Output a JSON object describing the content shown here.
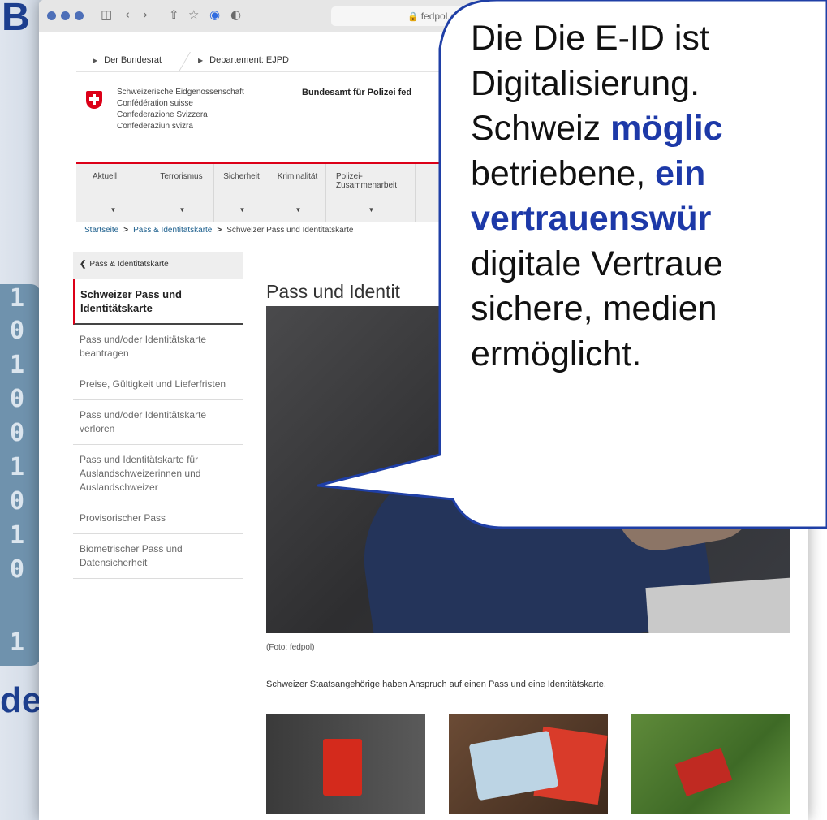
{
  "background": {
    "letter_top": "B",
    "letter_bottom": "de",
    "bits": [
      "1",
      "0",
      "1",
      "0",
      "0",
      "1",
      "0",
      "1",
      "0",
      "1"
    ]
  },
  "browser": {
    "url": "fedpol.a",
    "toolbar_icons": [
      "sidebar-icon",
      "back-icon",
      "forward-icon",
      "share-icon",
      "bookmark-icon",
      "password-icon",
      "shield-icon"
    ]
  },
  "site": {
    "top_crumbs": [
      "Der Bundesrat",
      "Departement: EJPD"
    ],
    "confederation": [
      "Schweizerische Eidgenossenschaft",
      "Confédération suisse",
      "Confederazione Svizzera",
      "Confederaziun svizra"
    ],
    "office": "Bundesamt für Polizei fed",
    "nav": [
      "Aktuell",
      "Terrorismus",
      "Sicherheit",
      "Kriminalität",
      "Polizei-\nZusammenarbeit"
    ],
    "breadcrumb": [
      "Startseite",
      "Pass & Identitätskarte",
      "Schweizer Pass und Identitätskarte"
    ],
    "sidebar_back": "Pass & Identitätskarte",
    "sidebar_items": [
      "Schweizer Pass und Identitätskarte",
      "Pass und/oder Identitätskarte beantragen",
      "Preise, Gültigkeit und Lieferfristen",
      "Pass und/oder Identitätskarte verloren",
      "Pass und Identitätskarte für Auslandschweizerinnen und Auslandschweizer",
      "Provisorischer Pass",
      "Biometrischer Pass und Datensicherheit"
    ],
    "heading": "Pass und Identit",
    "caption": "(Foto: fedpol)",
    "lead": "Schweizer Staatsangehörige haben Anspruch auf einen Pass und eine Identitätskarte."
  },
  "bubble": {
    "line1": "Die Die E-ID ist",
    "line2": "Digitalisierung.",
    "line3_a": "Schweiz ",
    "line3_b": "möglic",
    "line4_a": "betriebene, ",
    "line4_b": "ein",
    "line5": "vertrauenswür",
    "line6": "digitale Vertraue",
    "line7": "sichere, medien",
    "line8": "ermöglicht."
  },
  "colors": {
    "accent_red": "#dc0018",
    "bubble_emphasis": "#1d39a8",
    "bubble_border": "#1f3fa6"
  }
}
